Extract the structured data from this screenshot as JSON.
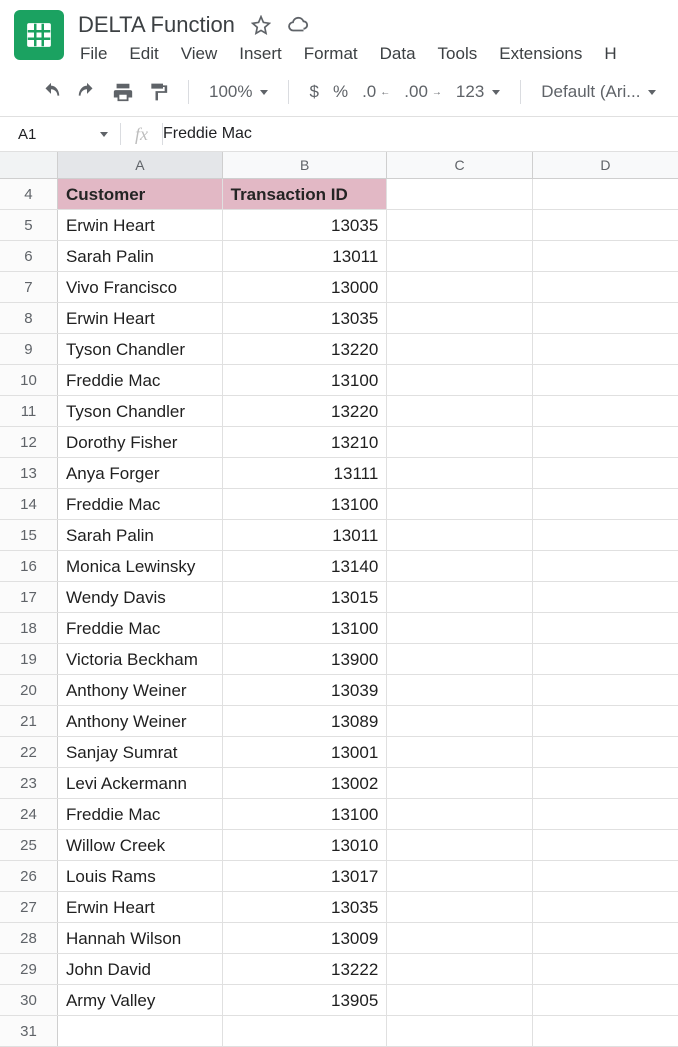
{
  "doc_title": "DELTA Function",
  "menu": {
    "file": "File",
    "edit": "Edit",
    "view": "View",
    "insert": "Insert",
    "format": "Format",
    "data": "Data",
    "tools": "Tools",
    "extensions": "Extensions",
    "help": "H"
  },
  "toolbar": {
    "zoom": "100%",
    "currency": "$",
    "percent": "%",
    "dec_decrease": ".0",
    "dec_increase": ".00",
    "number_format": "123",
    "font": "Default (Ari..."
  },
  "name_box": "A1",
  "formula": "Freddie Mac",
  "columns": {
    "a": "A",
    "b": "B",
    "c": "C",
    "d": "D"
  },
  "header_row_num": "4",
  "table_headers": {
    "customer": "Customer",
    "transaction": "Transaction ID"
  },
  "rows": [
    {
      "n": "5",
      "customer": "Erwin Heart",
      "tx": "13035"
    },
    {
      "n": "6",
      "customer": "Sarah Palin",
      "tx": "13011"
    },
    {
      "n": "7",
      "customer": "Vivo Francisco",
      "tx": "13000"
    },
    {
      "n": "8",
      "customer": "Erwin Heart",
      "tx": "13035"
    },
    {
      "n": "9",
      "customer": "Tyson Chandler",
      "tx": "13220"
    },
    {
      "n": "10",
      "customer": "Freddie Mac",
      "tx": "13100"
    },
    {
      "n": "11",
      "customer": "Tyson Chandler",
      "tx": "13220"
    },
    {
      "n": "12",
      "customer": "Dorothy Fisher",
      "tx": "13210"
    },
    {
      "n": "13",
      "customer": "Anya Forger",
      "tx": "13111"
    },
    {
      "n": "14",
      "customer": "Freddie Mac",
      "tx": "13100"
    },
    {
      "n": "15",
      "customer": "Sarah Palin",
      "tx": "13011"
    },
    {
      "n": "16",
      "customer": "Monica Lewinsky",
      "tx": "13140"
    },
    {
      "n": "17",
      "customer": "Wendy Davis",
      "tx": "13015"
    },
    {
      "n": "18",
      "customer": "Freddie Mac",
      "tx": "13100"
    },
    {
      "n": "19",
      "customer": "Victoria Beckham",
      "tx": "13900"
    },
    {
      "n": "20",
      "customer": "Anthony Weiner",
      "tx": "13039"
    },
    {
      "n": "21",
      "customer": "Anthony Weiner",
      "tx": "13089"
    },
    {
      "n": "22",
      "customer": "Sanjay Sumrat",
      "tx": "13001"
    },
    {
      "n": "23",
      "customer": "Levi Ackermann",
      "tx": "13002"
    },
    {
      "n": "24",
      "customer": "Freddie Mac",
      "tx": "13100"
    },
    {
      "n": "25",
      "customer": "Willow Creek",
      "tx": "13010"
    },
    {
      "n": "26",
      "customer": "Louis Rams",
      "tx": "13017"
    },
    {
      "n": "27",
      "customer": "Erwin Heart",
      "tx": "13035"
    },
    {
      "n": "28",
      "customer": "Hannah Wilson",
      "tx": "13009"
    },
    {
      "n": "29",
      "customer": "John David",
      "tx": "13222"
    },
    {
      "n": "30",
      "customer": "Army Valley",
      "tx": "13905"
    }
  ],
  "empty_row_num": "31"
}
